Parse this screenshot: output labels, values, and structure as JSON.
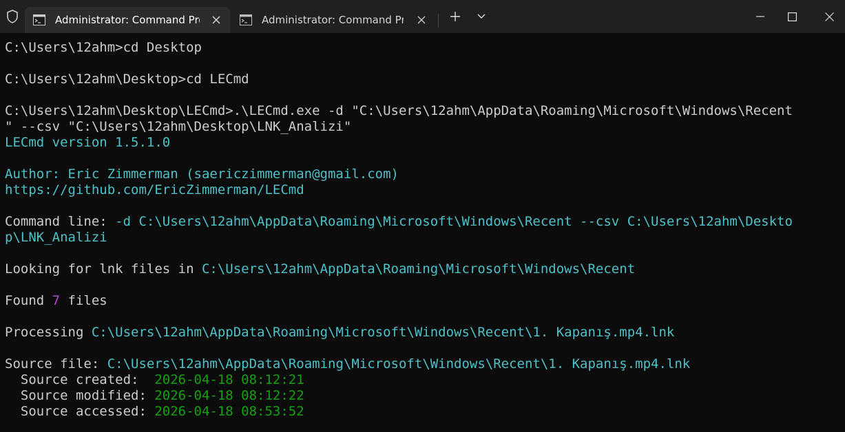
{
  "window": {
    "tabs": [
      {
        "title": "Administrator: Command Pro",
        "icon": "cmd-icon",
        "active": true
      },
      {
        "title": "Administrator: Command Pron",
        "icon": "cmd-icon",
        "active": false
      }
    ],
    "new_tab_symbol": "+",
    "controls": [
      "minimize",
      "maximize",
      "close"
    ]
  },
  "colors": {
    "background": "#0c0c0c",
    "titlebar": "#202020",
    "text": "#cccccc",
    "cyan": "#4bc2c9",
    "magenta": "#b548c6",
    "green": "#13a10e"
  },
  "terminal": {
    "cmd1": "C:\\Users\\12ahm>cd Desktop",
    "cmd2": "C:\\Users\\12ahm\\Desktop>cd LECmd",
    "cmd3_line1": "C:\\Users\\12ahm\\Desktop\\LECmd>.\\LECmd.exe -d \"C:\\Users\\12ahm\\AppData\\Roaming\\Microsoft\\Windows\\Recent",
    "cmd3_line2": "\" --csv \"C:\\Users\\12ahm\\Desktop\\LNK_Analizi\"",
    "version": "LECmd version 1.5.1.0",
    "author": "Author: Eric Zimmerman (saericzimmerman@gmail.com)",
    "url": "https://github.com/EricZimmerman/LECmd",
    "cmdline_label": "Command line: ",
    "cmdline_line1": "-d C:\\Users\\12ahm\\AppData\\Roaming\\Microsoft\\Windows\\Recent --csv C:\\Users\\12ahm\\Deskto",
    "cmdline_line2": "p\\LNK_Analizi",
    "looking_label": "Looking for lnk files in ",
    "looking_path": "C:\\Users\\12ahm\\AppData\\Roaming\\Microsoft\\Windows\\Recent",
    "found_label": "Found ",
    "found_count": "7",
    "found_suffix": " files",
    "processing_label": "Processing ",
    "processing_path": "C:\\Users\\12ahm\\AppData\\Roaming\\Microsoft\\Windows\\Recent\\1. Kapanış.mp4.lnk",
    "source_file_label": "Source file: ",
    "source_file_path": "C:\\Users\\12ahm\\AppData\\Roaming\\Microsoft\\Windows\\Recent\\1. Kapanış.mp4.lnk",
    "source_created_label": "  Source created:  ",
    "source_created_value": "2026-04-18 08:12:21",
    "source_modified_label": "  Source modified: ",
    "source_modified_value": "2026-04-18 08:12:22",
    "source_accessed_label": "  Source accessed: ",
    "source_accessed_value": "2026-04-18 08:53:52"
  }
}
